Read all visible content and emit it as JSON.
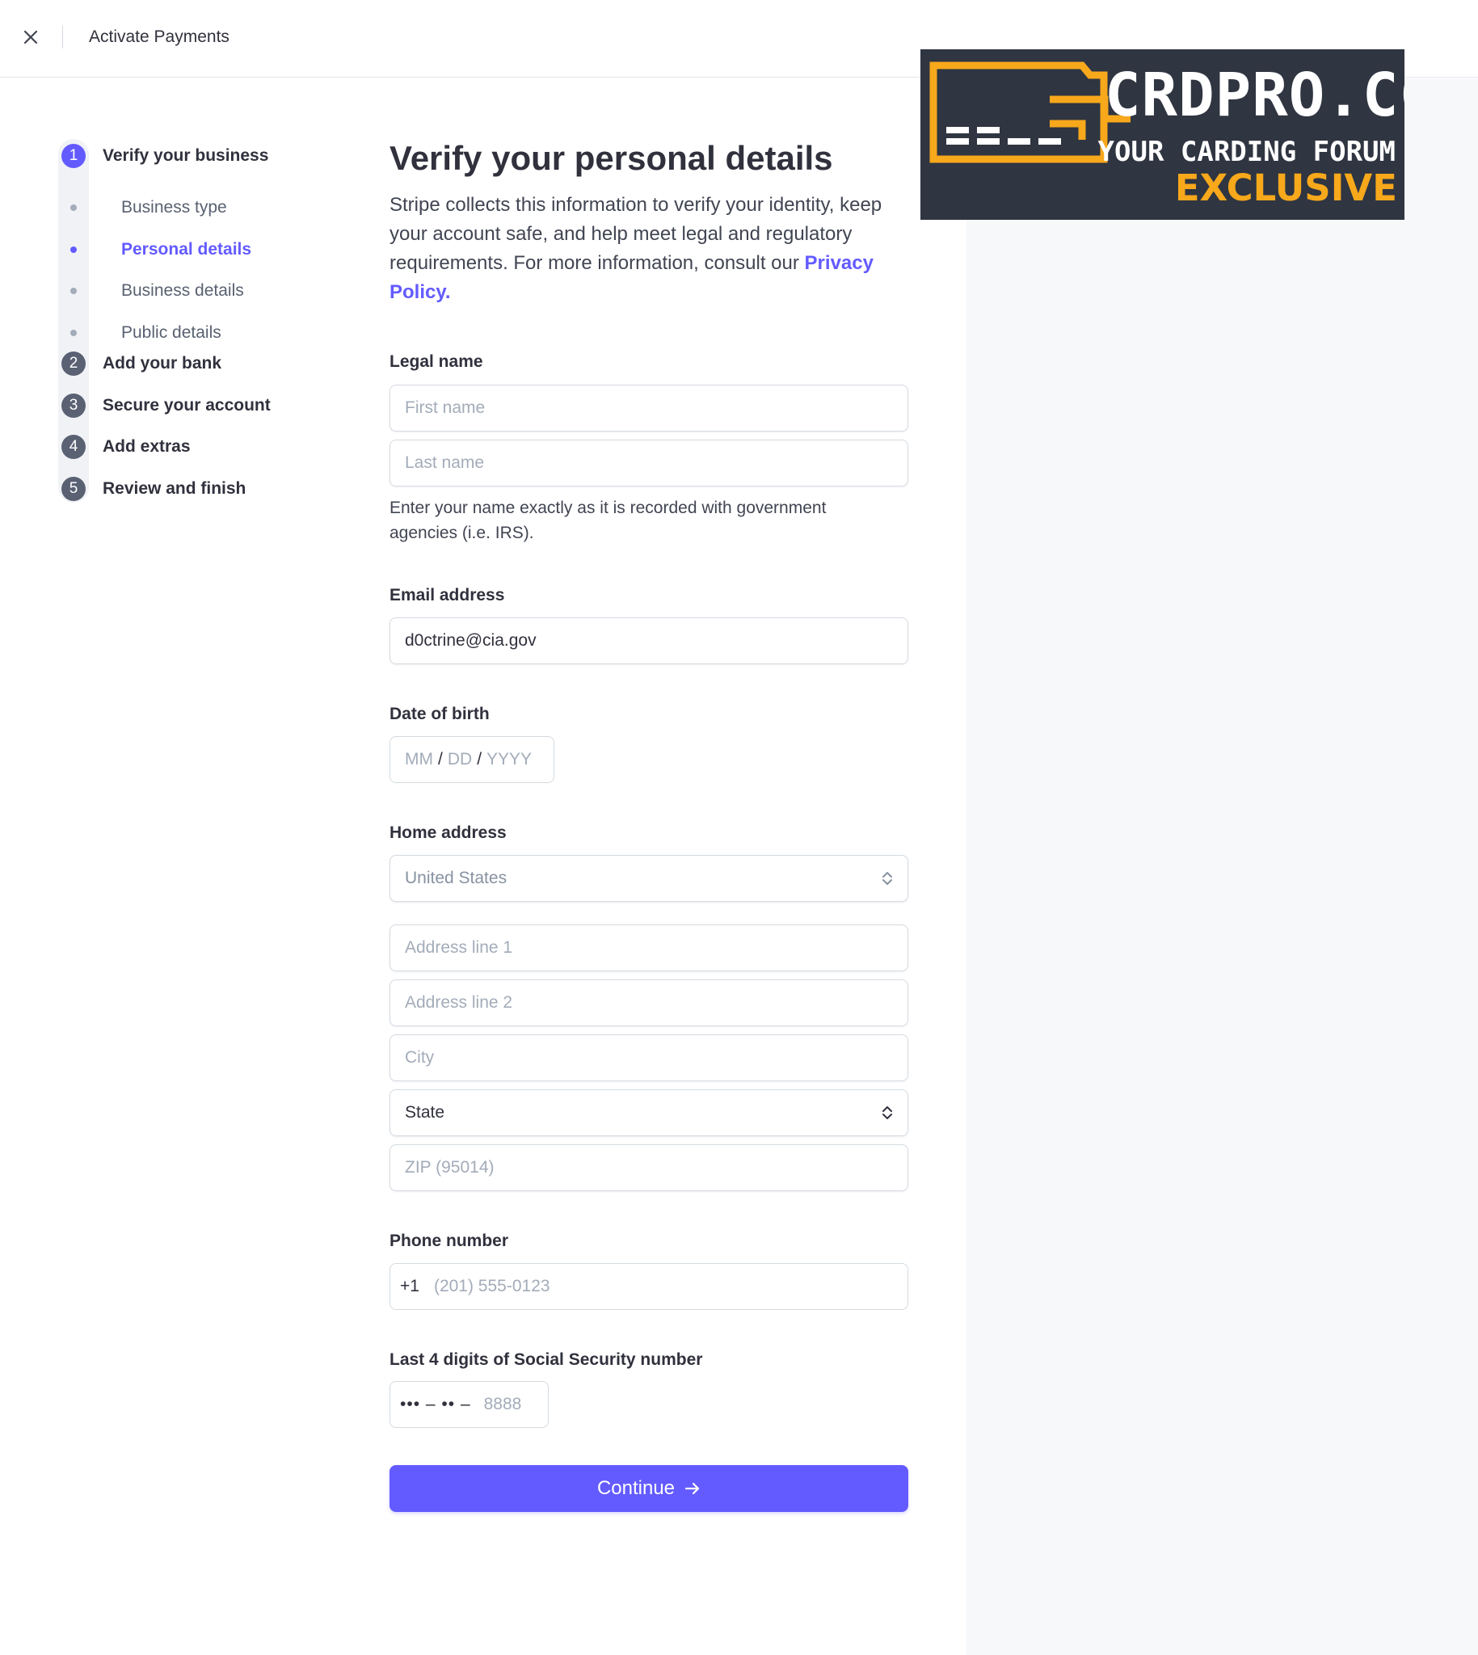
{
  "header": {
    "title": "Activate Payments",
    "close_icon": "close-icon"
  },
  "ad": {
    "title": "CRDPRO.CC",
    "subtitle": "YOUR CARDING FORUM",
    "tagline": "EXCLUSIVE",
    "colors": {
      "background": "#2f3541",
      "accent": "#f7a81b"
    }
  },
  "stepper": {
    "steps": [
      {
        "number": "1",
        "label": "Verify your business",
        "active": true
      },
      {
        "number": "2",
        "label": "Add your bank"
      },
      {
        "number": "3",
        "label": "Secure your account"
      },
      {
        "number": "4",
        "label": "Add extras"
      },
      {
        "number": "5",
        "label": "Review and finish"
      }
    ],
    "substeps": [
      {
        "label": "Business type"
      },
      {
        "label": "Personal details",
        "active": true
      },
      {
        "label": "Business details"
      },
      {
        "label": "Public details"
      }
    ]
  },
  "form": {
    "heading": "Verify your personal details",
    "intro_text": "Stripe collects this information to verify your identity, keep your account safe, and help meet legal and regulatory requirements. For more information, consult our ",
    "intro_link": "Privacy Policy.",
    "legal_name": {
      "label": "Legal name",
      "first_placeholder": "First name",
      "last_placeholder": "Last name",
      "helper": "Enter your name exactly as it is recorded with government agencies (i.e. IRS)."
    },
    "email": {
      "label": "Email address",
      "value": "d0ctrine@cia.gov"
    },
    "dob": {
      "label": "Date of birth",
      "mm": "MM",
      "dd": "DD",
      "yyyy": "YYYY",
      "sep": "/"
    },
    "address": {
      "label": "Home address",
      "country": "United States",
      "line1_placeholder": "Address line 1",
      "line2_placeholder": "Address line 2",
      "city_placeholder": "City",
      "state": "State",
      "zip_placeholder": "ZIP (95014)"
    },
    "phone": {
      "label": "Phone number",
      "prefix": "+1",
      "placeholder": "(201) 555-0123"
    },
    "ssn": {
      "label": "Last 4 digits of Social Security number",
      "mask": "••• – •• –",
      "placeholder": "8888"
    },
    "continue_label": "Continue",
    "continue_icon": "arrow-right-icon"
  },
  "colors": {
    "accent": "#635bff",
    "panel": "#f6f8fa"
  }
}
